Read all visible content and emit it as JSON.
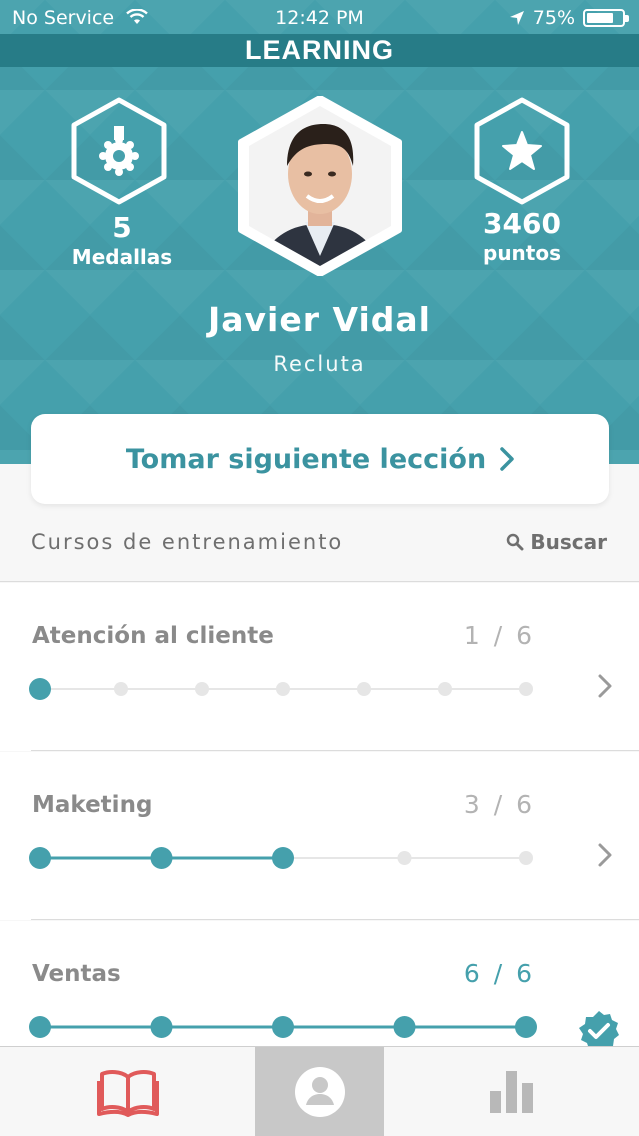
{
  "status_bar": {
    "carrier": "No Service",
    "time": "12:42 PM",
    "battery": "75%",
    "battery_level": 0.75
  },
  "app_title": "LEARNING",
  "profile": {
    "medals_count": "5",
    "medals_label": "Medallas",
    "points_count": "3460",
    "points_label": "puntos",
    "name": "Javier Vidal",
    "rank": "Recluta"
  },
  "cta_label": "Tomar siguiente lección",
  "courses_section": {
    "label": "Cursos de entrenamiento",
    "search_label": "Buscar"
  },
  "courses": [
    {
      "title": "Atención al cliente",
      "progress_text": "1 / 6",
      "completed_steps": 1,
      "total_steps": 6,
      "done": false
    },
    {
      "title": "Maketing",
      "progress_text": "3 / 6",
      "completed_steps": 3,
      "total_steps": 6,
      "done": false
    },
    {
      "title": "Ventas",
      "progress_text": "6 / 6",
      "completed_steps": 6,
      "total_steps": 6,
      "done": true
    }
  ],
  "colors": {
    "accent": "#45a0ac",
    "title_bar": "#277c87",
    "book_icon": "#e05a5a",
    "inactive": "#b8b8b8"
  },
  "tab_bar": {
    "tabs": [
      "book-icon",
      "profile-icon",
      "bar-chart-icon"
    ],
    "active": "profile-icon"
  }
}
